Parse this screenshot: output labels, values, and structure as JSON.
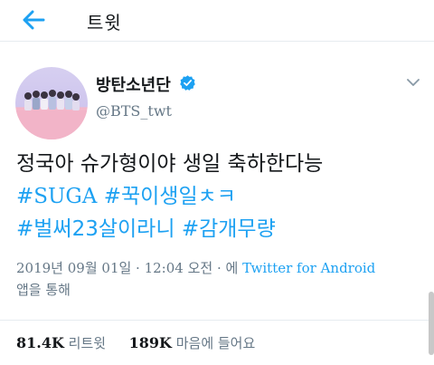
{
  "header": {
    "title": "트윗",
    "back_icon": "arrow-left-icon",
    "accent": "#1da1f2"
  },
  "tweet": {
    "display_name": "방탄소년단",
    "handle": "@BTS_twt",
    "verified": true,
    "verified_icon": "verified-badge-icon",
    "menu_icon": "chevron-down-icon",
    "text_plain": "정국아 슈가형이야 생일 축하한다능",
    "hashtags": [
      "#SUGA",
      "#꾹이생일ㅊㅋ",
      "#벌써23살이라니",
      "#감개무량"
    ],
    "timestamp": "2019년 09월 01일 · 12:04 오전 · 에",
    "source": "Twitter for Android",
    "source_suffix": "앱을 통해"
  },
  "stats": {
    "retweets_count": "81.4K",
    "retweets_label": "리트윗",
    "likes_count": "189K",
    "likes_label": "마음에 들어요"
  },
  "colors": {
    "link": "#1da1f2",
    "secondary": "#657786",
    "text": "#14171a"
  }
}
